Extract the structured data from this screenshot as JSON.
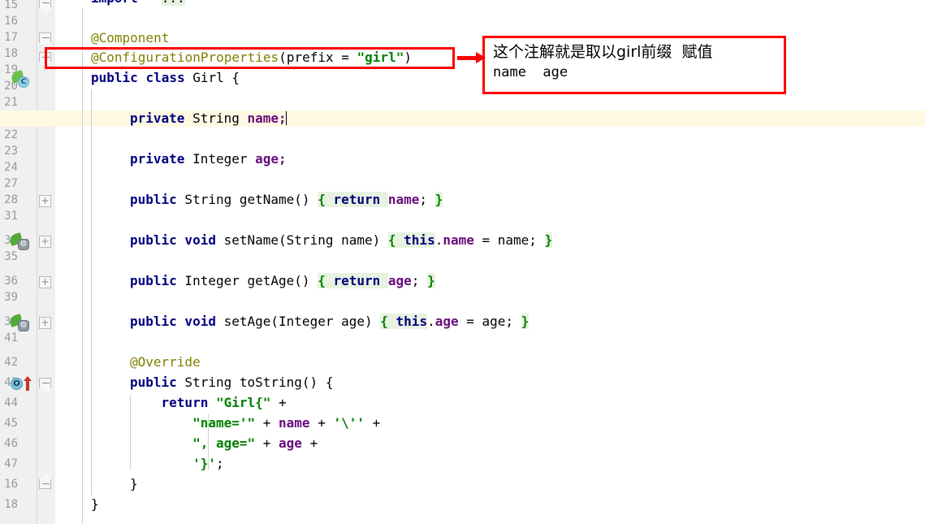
{
  "editor": {
    "language": "java",
    "colors": {
      "background": "#ffffff",
      "gutter_background": "#f0f0f0",
      "line_number": "#999999",
      "caret_line": "#fff9e3",
      "keyword": "#000080",
      "annotation": "#808000",
      "string": "#008000",
      "field": "#660e7a",
      "brace_highlight": "#e8f2e0",
      "marker_red": "#ff0000"
    },
    "caret_line_number": "20"
  },
  "line_numbers": [
    "15",
    "16",
    "16",
    "17",
    "18",
    "19",
    "20",
    "21",
    "22",
    "23",
    "24",
    "27",
    "28",
    "31",
    "32",
    "35",
    "36",
    "39",
    "39",
    "41",
    "42",
    "43",
    "44",
    "45",
    "46",
    "47"
  ],
  "gutter": {
    "icons": [
      {
        "name": "spring-bean-class-icon",
        "line": 18,
        "badge": "C"
      },
      {
        "name": "spring-bean-setter-icon",
        "line": 28,
        "badge": "⚙"
      },
      {
        "name": "spring-bean-setter-icon",
        "line": 36,
        "badge": "⚙"
      },
      {
        "name": "override-method-icon",
        "line": 41,
        "badge": "O"
      }
    ],
    "fold_markers": [
      {
        "name": "fold-collapse-import",
        "line": 15,
        "state": "collapse"
      },
      {
        "name": "fold-collapse-class-annotation",
        "line": 16,
        "state": "collapse"
      },
      {
        "name": "fold-collapse-annotation",
        "line": 17,
        "state": "collapse"
      },
      {
        "name": "fold-expand-getname",
        "line": 24,
        "state": "expand"
      },
      {
        "name": "fold-expand-setname",
        "line": 28,
        "state": "expand"
      },
      {
        "name": "fold-expand-getage",
        "line": 32,
        "state": "expand"
      },
      {
        "name": "fold-expand-setage",
        "line": 36,
        "state": "expand"
      },
      {
        "name": "fold-collapse-tostring",
        "line": 41,
        "state": "collapse"
      },
      {
        "name": "fold-collapse-class-end",
        "line": 46,
        "state": "collapse"
      }
    ]
  },
  "code": {
    "l15_import_kw": "import",
    "l15_import_fold": "...",
    "l17_component": "@Component",
    "l18_annotation": "@ConfigurationProperties(prefix = \"girl\")",
    "l18_anno_name": "@ConfigurationProperties",
    "l18_anno_open": "(",
    "l18_anno_param": "prefix",
    "l18_anno_eq": " = ",
    "l18_anno_value": "\"girl\"",
    "l18_anno_close": ")",
    "l19_public": "public",
    "l19_class": "class",
    "l19_name": " Girl {",
    "l20_private": "private",
    "l20_type": " String ",
    "l20_field": "name",
    "l20_semi": ";",
    "l22_private": "private",
    "l22_type": " Integer ",
    "l22_field": "age",
    "l22_semi": ";",
    "l24_public": "public",
    "l24_sig": " String getName() ",
    "l24_open": "{",
    "l24_return": " return ",
    "l24_field": "name",
    "l24_semi": "; ",
    "l24_close": "}",
    "l28_public": "public",
    "l28_void": " void",
    "l28_sig": " setName(String name) ",
    "l28_open": "{",
    "l28_this": " this",
    "l28_dot": ".",
    "l28_field": "name",
    "l28_assign": " = name; ",
    "l28_close": "}",
    "l32_public": "public",
    "l32_sig": " Integer getAge() ",
    "l32_open": "{",
    "l32_return": " return ",
    "l32_field": "age",
    "l32_semi": "; ",
    "l32_close": "}",
    "l36_public": "public",
    "l36_void": " void",
    "l36_sig": " setAge(Integer age) ",
    "l36_open": "{",
    "l36_this": " this",
    "l36_dot": ".",
    "l36_field": "age",
    "l36_assign": " = age; ",
    "l36_close": "}",
    "l39_override": "@Override",
    "l41_public": "public",
    "l41_sig": " String toString() {",
    "l42_return": "return",
    "l42_str": " \"Girl{\"",
    "l42_plus": " +",
    "l43_str": "\"name='\"",
    "l43_plus1": " + ",
    "l43_field": "name",
    "l43_plus2": " + ",
    "l43_char": "'\\''",
    "l43_plus3": " +",
    "l44_str": "\", age=\"",
    "l44_plus1": " + ",
    "l44_field": "age",
    "l44_plus2": " +",
    "l45_char": "'}'",
    "l45_semi": ";",
    "l46_close": "}",
    "l47_close": "}"
  },
  "annotation_overlay": {
    "highlight_target_line": "18",
    "note_line1": "这个注解就是取以girl前缀  赋值",
    "note_line2": "name  age",
    "arrow": "→"
  }
}
